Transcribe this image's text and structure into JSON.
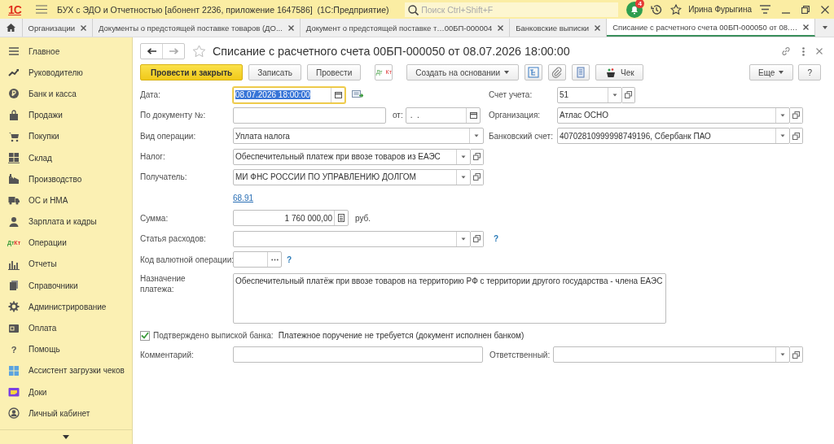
{
  "app_bar": {
    "logo": "1С",
    "title": "БУХ с ЭДО и Отчетностью [абонент 2236, приложение 1647586]  (1С:Предприятие)",
    "search": {
      "placeholder": "Поиск Ctrl+Shift+F"
    },
    "notifications": "4",
    "user": "Ирина Фурыгина"
  },
  "tabs": [
    {
      "label": "Организации",
      "selected": false
    },
    {
      "label": "Документы о предстоящей поставке товаров (ДО...",
      "selected": false
    },
    {
      "label": "Документ о предстоящей поставке т…00БП-000004",
      "selected": false
    },
    {
      "label": "Банковские выписки",
      "selected": false
    },
    {
      "label": "Списание с расчетного счета 00БП-000050 от 08.…",
      "selected": true
    }
  ],
  "sidebar": {
    "items": [
      {
        "label": "Главное"
      },
      {
        "label": "Руководителю"
      },
      {
        "label": "Банк и касса"
      },
      {
        "label": "Продажи"
      },
      {
        "label": "Покупки"
      },
      {
        "label": "Склад"
      },
      {
        "label": "Производство"
      },
      {
        "label": "ОС и НМА"
      },
      {
        "label": "Зарплата и кадры"
      },
      {
        "label": "Операции",
        "icon_text": "$^{Дт}$$_{Кт}$"
      },
      {
        "label": "Отчеты"
      },
      {
        "label": "Справочники"
      },
      {
        "label": "Администрирование"
      },
      {
        "label": "Оплата"
      },
      {
        "label": "Помощь",
        "icon_text": "?"
      },
      {
        "label": "Ассистент загрузки чеков"
      },
      {
        "label": "Доки"
      },
      {
        "label": "Личный кабинет"
      }
    ]
  },
  "document": {
    "title": "Списание с расчетного счета 00БП-000050 от 08.07.2026 18:00:00",
    "starred": false,
    "toolbar": [
      {
        "kind": "primary",
        "label": "Провести и закрыть"
      },
      {
        "kind": "button",
        "label": "Записать"
      },
      {
        "kind": "button",
        "label": "Провести"
      },
      {
        "kind": "dtkt",
        "label": "$^{Дт}$$_{Кт}$"
      },
      {
        "kind": "menu",
        "label": "Создать на основании"
      },
      {
        "kind": "icon"
      },
      {
        "kind": "icon"
      },
      {
        "kind": "icon"
      },
      {
        "kind": "check",
        "label": "Чек"
      }
    ],
    "toolbar_right": [
      {
        "kind": "menu",
        "label": "Еще"
      },
      {
        "kind": "button",
        "label": "?"
      }
    ],
    "fields": {
      "date": {
        "label": "Дата:",
        "value": "08.07.2026 18:00:00",
        "focused": true
      },
      "doc_number": {
        "label": "По документу №:"
      },
      "doc_date": {
        "label": "от:",
        "value": " .  ."
      },
      "operation": {
        "label": "Вид операции:",
        "value": "Уплата налога"
      },
      "tax": {
        "label": "Налог:",
        "value": "Обеспечительный платеж при ввозе товаров из ЕАЭС"
      },
      "recipient": {
        "label": "Получатель:",
        "value": "МИ ФНС РОССИИ ПО УПРАВЛЕНИЮ ДОЛГОМ"
      },
      "account_link": "68.91",
      "amount": {
        "label": "Сумма:",
        "value": "1 760 000,00",
        "unit": "руб."
      },
      "expense_item": {
        "label": "Статья расходов:",
        "help": "?"
      },
      "currency_code": {
        "label": "Код валютной операции:",
        "help": "?"
      },
      "purpose": {
        "label": "Назначение платежа:",
        "value": "Обеспечительный платёж при ввозе товаров на территорию РФ с территории другого государства - члена ЕАЭС"
      },
      "confirmed": {
        "label": "Подтверждено выпиской банка:",
        "checked": true,
        "note": "Платежное поручение не требуется (документ исполнен банком)"
      },
      "comment": {
        "label": "Комментарий:"
      },
      "responsible": {
        "label": "Ответственный:"
      },
      "account": {
        "label": "Счет учета:",
        "value": "51"
      },
      "organization": {
        "label": "Организация:",
        "value": "Атлас ОСНО"
      },
      "bank_account": {
        "label": "Банковский счет:",
        "value": "40702810999998749196, Сбербанк ПАО"
      }
    }
  }
}
